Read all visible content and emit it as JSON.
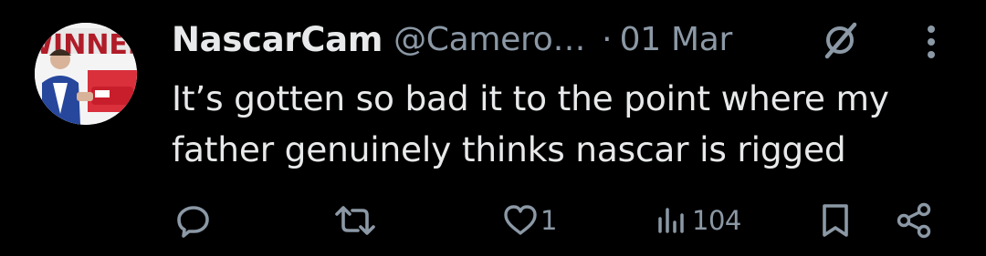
{
  "tweet": {
    "display_name": "NascarCam",
    "handle": "@Camero…",
    "separator": "·",
    "date": "01 Mar",
    "text_line1": "It’s gotten so bad it to the point where my",
    "text_line2": "father genuinely thinks nascar is rigged",
    "avatar_text": "WINNER"
  },
  "actions": {
    "reply_count": "",
    "retweet_count": "",
    "like_count": "1",
    "views_count": "104"
  },
  "colors": {
    "background": "#000000",
    "primary_text": "#e7e9ea",
    "secondary_text": "#8b98a5"
  },
  "icons": [
    "grok-icon",
    "more-icon",
    "reply-icon",
    "retweet-icon",
    "like-icon",
    "views-icon",
    "bookmark-icon",
    "share-icon"
  ]
}
